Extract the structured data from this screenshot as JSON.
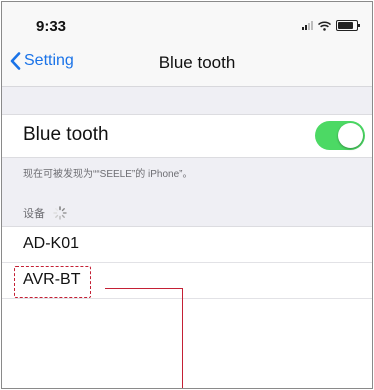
{
  "status_bar": {
    "time": "9:33",
    "icons": [
      "signal-icon",
      "wifi-icon",
      "battery-icon"
    ]
  },
  "nav": {
    "back_label": "Setting",
    "title": "Blue tooth"
  },
  "bluetooth": {
    "label": "Blue tooth",
    "enabled": true,
    "toggle_color": "#4cd964"
  },
  "discoverable_text": "现在可被发现为““SEELE”的 iPhone”。",
  "devices_header": "设备",
  "devices": [
    {
      "name": "AD-K01"
    },
    {
      "name": "AVR-BT"
    }
  ],
  "colors": {
    "accent": "#1a73e8",
    "annotation": "#c42035"
  }
}
